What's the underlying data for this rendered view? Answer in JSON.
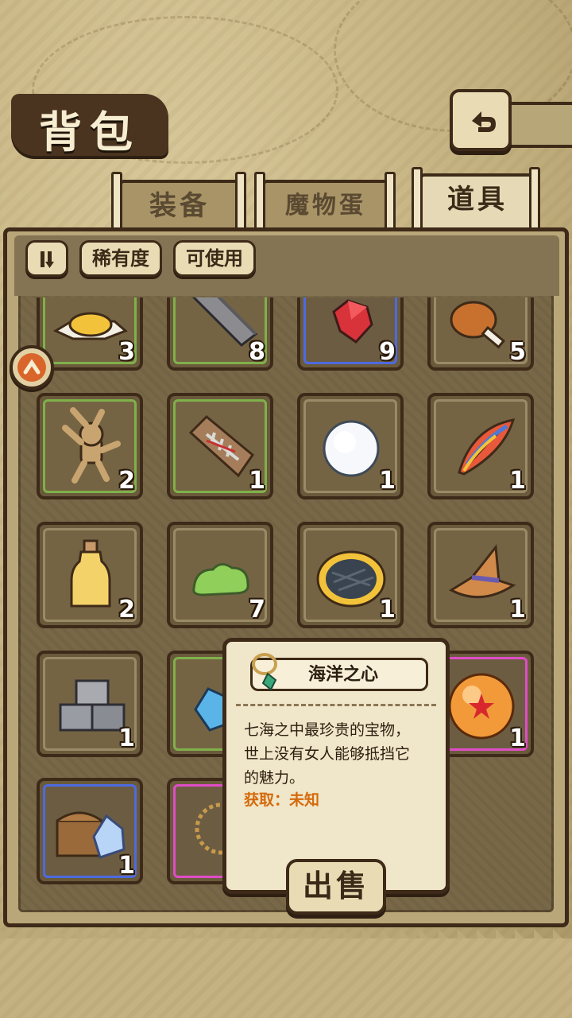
{
  "header": {
    "title": "背包"
  },
  "tabs": [
    {
      "label": "装备",
      "active": false
    },
    {
      "label": "魔物蛋",
      "active": false
    },
    {
      "label": "道具",
      "active": true
    }
  ],
  "filters": {
    "sort_icon": "sort-toggle-icon",
    "rarity_label": "稀有度",
    "usable_label": "可使用"
  },
  "items": [
    {
      "icon": "cheese-plate-icon",
      "count": "3",
      "rarity": "green"
    },
    {
      "icon": "stone-beam-icon",
      "count": "8",
      "rarity": "green"
    },
    {
      "icon": "red-gem-icon",
      "count": "9",
      "rarity": "blue"
    },
    {
      "icon": "meat-drumstick-icon",
      "count": "5",
      "rarity": "plain"
    },
    {
      "icon": "voodoo-doll-icon",
      "count": "2",
      "rarity": "green"
    },
    {
      "icon": "fish-bone-tablet-icon",
      "count": "1",
      "rarity": "green"
    },
    {
      "icon": "snowball-icon",
      "count": "1",
      "rarity": "plain"
    },
    {
      "icon": "rainbow-feather-icon",
      "count": "1",
      "rarity": "plain"
    },
    {
      "icon": "potion-bottle-icon",
      "count": "2",
      "rarity": "plain"
    },
    {
      "icon": "green-slime-icon",
      "count": "7",
      "rarity": "plain"
    },
    {
      "icon": "pie-icon",
      "count": "1",
      "rarity": "plain"
    },
    {
      "icon": "wizard-hat-icon",
      "count": "1",
      "rarity": "plain"
    },
    {
      "icon": "stone-blocks-icon",
      "count": "1",
      "rarity": "plain"
    },
    {
      "icon": "blue-crystal-icon",
      "count": "",
      "rarity": "green"
    },
    {
      "icon": "hidden-item-icon",
      "count": "",
      "rarity": "plain"
    },
    {
      "icon": "star-orb-icon",
      "count": "1",
      "rarity": "pink"
    },
    {
      "icon": "treasure-chest-icon",
      "count": "1",
      "rarity": "blue"
    },
    {
      "icon": "flower-necklace-icon",
      "count": "",
      "rarity": "pink"
    }
  ],
  "tooltip": {
    "icon": "necklace-icon",
    "name": "海洋之心",
    "desc_line1": "七海之中最珍贵的宝物，",
    "desc_line2": "世上没有女人能够抵挡它",
    "desc_line3": "的魅力。",
    "source": "获取：未知"
  },
  "sell_label": "出售",
  "colors": {
    "rarity_green": "#7fb04a",
    "rarity_blue": "#4d6ae0",
    "rarity_pink": "#e04cc8",
    "source_orange": "#d46a0c"
  }
}
